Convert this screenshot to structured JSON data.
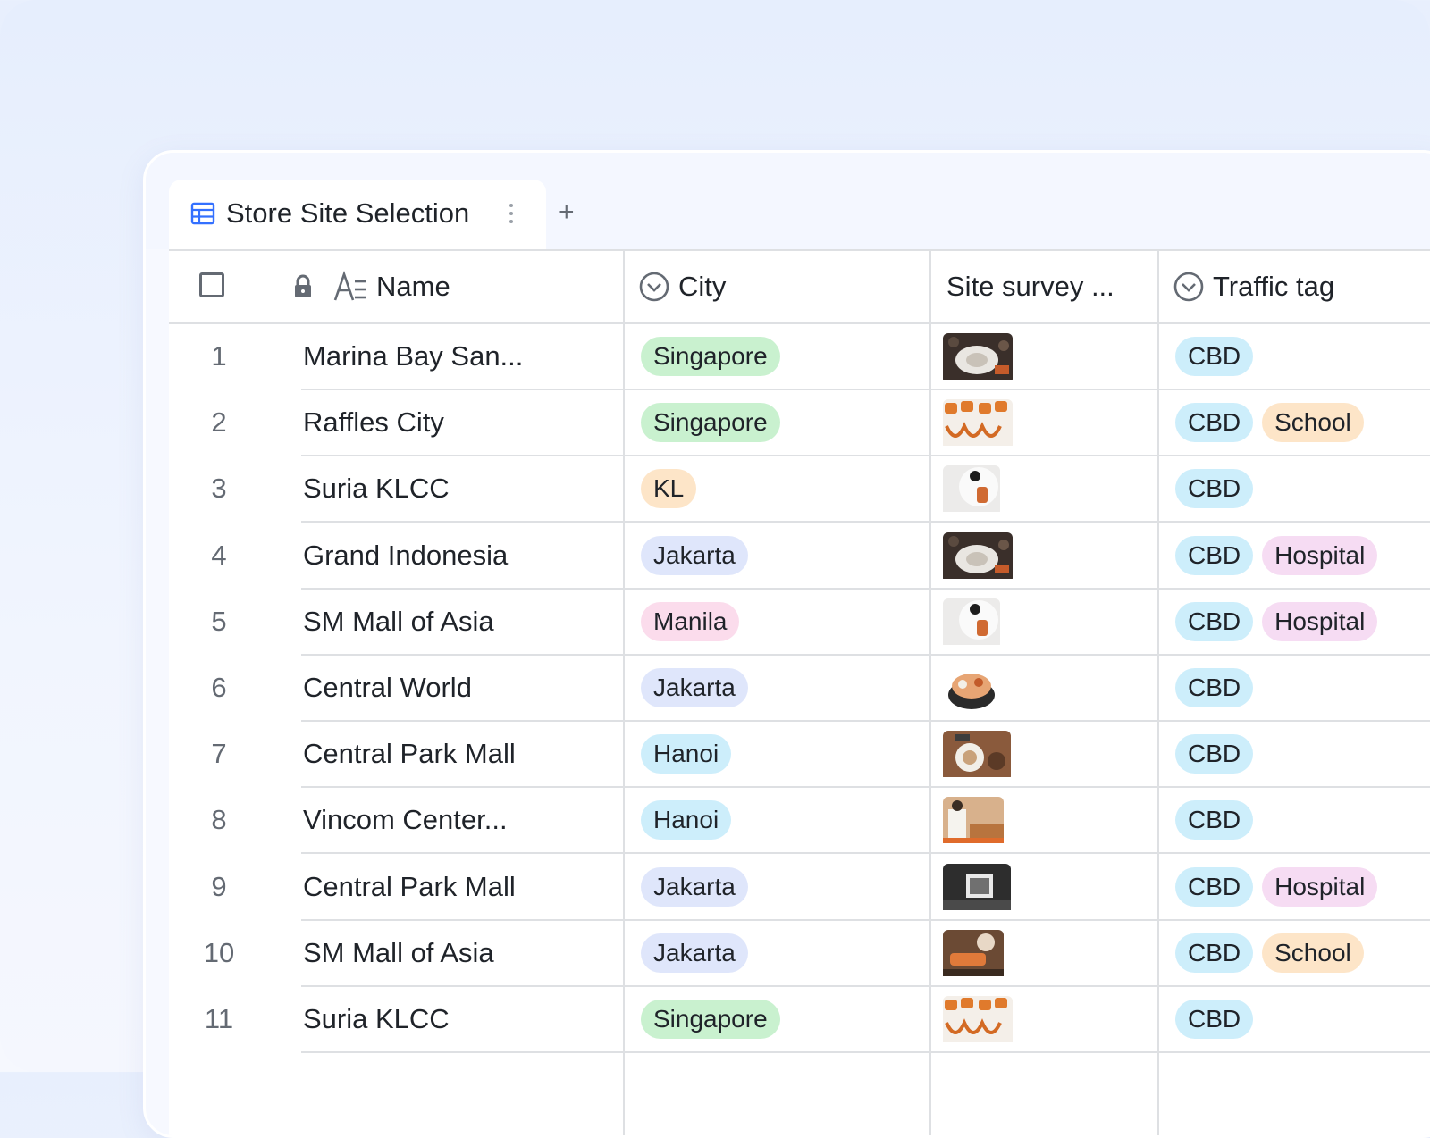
{
  "tab": {
    "title": "Store Site Selection",
    "add_label": "+"
  },
  "columns": {
    "name": "Name",
    "city": "City",
    "survey": "Site survey ...",
    "traffic": "Traffic tag"
  },
  "colors": {
    "Singapore": "#c9f1cf",
    "KL": "#fde5c8",
    "Jakarta": "#dfe6fb",
    "Manila": "#fbdcec",
    "Hanoi": "#cdeefb",
    "CBD": "#cdeefb",
    "School": "#fde5c8",
    "Hospital": "#f6dcf3"
  },
  "rows": [
    {
      "num": "1",
      "name": "Marina Bay San...",
      "city": "Singapore",
      "photo": "food-plate-photo",
      "tags": [
        "CBD"
      ]
    },
    {
      "num": "2",
      "name": "Raffles City",
      "city": "Singapore",
      "photo": "sushi-rolls-photo",
      "tags": [
        "CBD",
        "School"
      ]
    },
    {
      "num": "3",
      "name": "Suria KLCC",
      "city": "KL",
      "photo": "sushi-plate-photo",
      "tags": [
        "CBD"
      ]
    },
    {
      "num": "4",
      "name": "Grand Indonesia",
      "city": "Jakarta",
      "photo": "food-plate-photo",
      "tags": [
        "CBD",
        "Hospital"
      ]
    },
    {
      "num": "5",
      "name": "SM Mall of Asia",
      "city": "Manila",
      "photo": "sushi-plate-photo",
      "tags": [
        "CBD",
        "Hospital"
      ]
    },
    {
      "num": "6",
      "name": "Central World",
      "city": "Jakarta",
      "photo": "bowl-photo",
      "tags": [
        "CBD"
      ]
    },
    {
      "num": "7",
      "name": "Central Park Mall",
      "city": "Hanoi",
      "photo": "table-spread-photo",
      "tags": [
        "CBD"
      ]
    },
    {
      "num": "8",
      "name": "Vincom Center...",
      "city": "Hanoi",
      "photo": "chef-photo",
      "tags": [
        "CBD"
      ]
    },
    {
      "num": "9",
      "name": "Central Park Mall",
      "city": "Jakarta",
      "photo": "kitchen-photo",
      "tags": [
        "CBD",
        "Hospital"
      ]
    },
    {
      "num": "10",
      "name": "SM Mall of Asia",
      "city": "Jakarta",
      "photo": "chef-cooking-photo",
      "tags": [
        "CBD",
        "School"
      ]
    },
    {
      "num": "11",
      "name": "Suria KLCC",
      "city": "Singapore",
      "photo": "sushi-rolls-photo",
      "tags": [
        "CBD"
      ]
    }
  ]
}
